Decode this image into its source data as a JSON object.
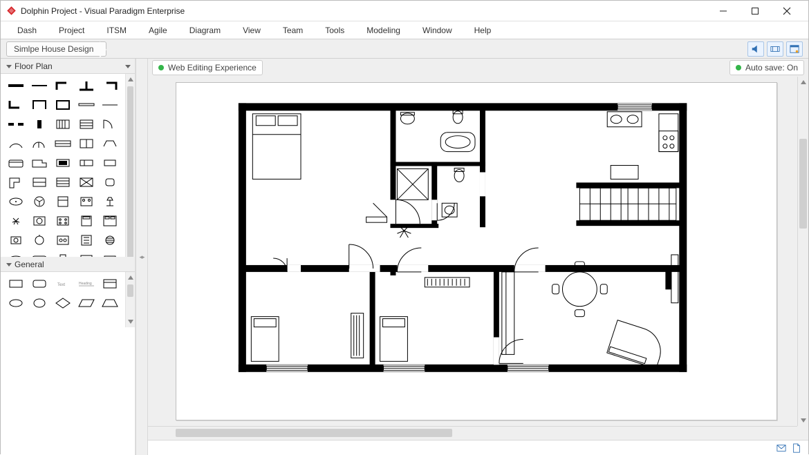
{
  "window": {
    "title": "Dolphin Project - Visual Paradigm Enterprise"
  },
  "menu": {
    "items": [
      "Dash",
      "Project",
      "ITSM",
      "Agile",
      "Diagram",
      "View",
      "Team",
      "Tools",
      "Modeling",
      "Window",
      "Help"
    ]
  },
  "breadcrumb": {
    "current": "Simlpe House Design"
  },
  "palette": {
    "categories": {
      "floorplan": "Floor Plan",
      "general": "General"
    }
  },
  "tabs": {
    "left": {
      "label": "Web Editing Experience",
      "dotColor": "#34b54a"
    },
    "right": {
      "label": "Auto save: On",
      "dotColor": "#34b54a"
    }
  },
  "colors": {
    "accent": "#2f6fb3",
    "logoRed": "#d7262a"
  }
}
